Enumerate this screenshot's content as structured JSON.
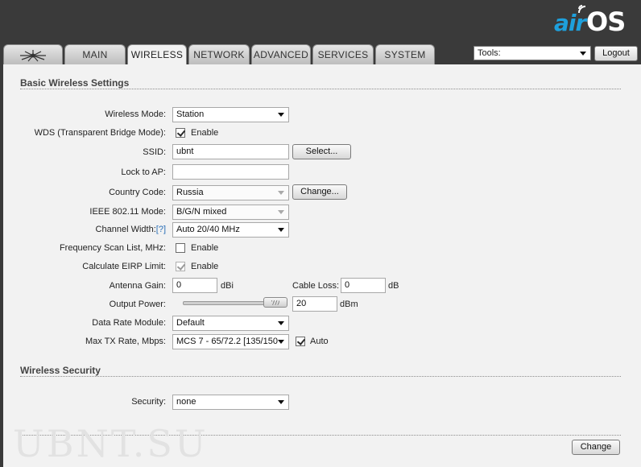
{
  "brand": {
    "logo_air": "air",
    "logo_os": "OS"
  },
  "tabs": [
    {
      "label": ""
    },
    {
      "label": "MAIN"
    },
    {
      "label": "WIRELESS"
    },
    {
      "label": "NETWORK"
    },
    {
      "label": "ADVANCED"
    },
    {
      "label": "SERVICES"
    },
    {
      "label": "SYSTEM"
    }
  ],
  "active_tab": "WIRELESS",
  "tools": {
    "label": "Tools:"
  },
  "logout_label": "Logout",
  "basic": {
    "title": "Basic Wireless Settings",
    "wireless_mode": {
      "label": "Wireless Mode:",
      "value": "Station"
    },
    "wds": {
      "label": "WDS (Transparent Bridge Mode):",
      "checked": true,
      "option": "Enable"
    },
    "ssid": {
      "label": "SSID:",
      "value": "ubnt",
      "button": "Select..."
    },
    "lock_ap": {
      "label": "Lock to AP:",
      "value": ""
    },
    "country": {
      "label": "Country Code:",
      "value": "Russia",
      "button": "Change..."
    },
    "ieee_mode": {
      "label": "IEEE 802.11 Mode:",
      "value": "B/G/N mixed"
    },
    "channel_width": {
      "label": "Channel Width:",
      "help": "[?]",
      "value": "Auto 20/40 MHz"
    },
    "freq_scan": {
      "label": "Frequency Scan List, MHz:",
      "checked": false,
      "option": "Enable"
    },
    "eirp": {
      "label": "Calculate EIRP Limit:",
      "checked": true,
      "option": "Enable"
    },
    "antenna_gain": {
      "label": "Antenna Gain:",
      "value": "0",
      "unit": "dBi"
    },
    "cable_loss": {
      "label": "Cable Loss:",
      "value": "0",
      "unit": "dB"
    },
    "output_power": {
      "label": "Output Power:",
      "value": "20",
      "unit": "dBm",
      "slider_fraction": 1.0
    },
    "data_rate": {
      "label": "Data Rate Module:",
      "value": "Default"
    },
    "max_tx": {
      "label": "Max TX Rate, Mbps:",
      "value": "MCS 7 - 65/72.2 [135/150",
      "auto_checked": true,
      "auto_label": "Auto"
    }
  },
  "security": {
    "title": "Wireless Security",
    "label": "Security:",
    "value": "none"
  },
  "change_label": "Change",
  "watermark": "UBNT.SU"
}
